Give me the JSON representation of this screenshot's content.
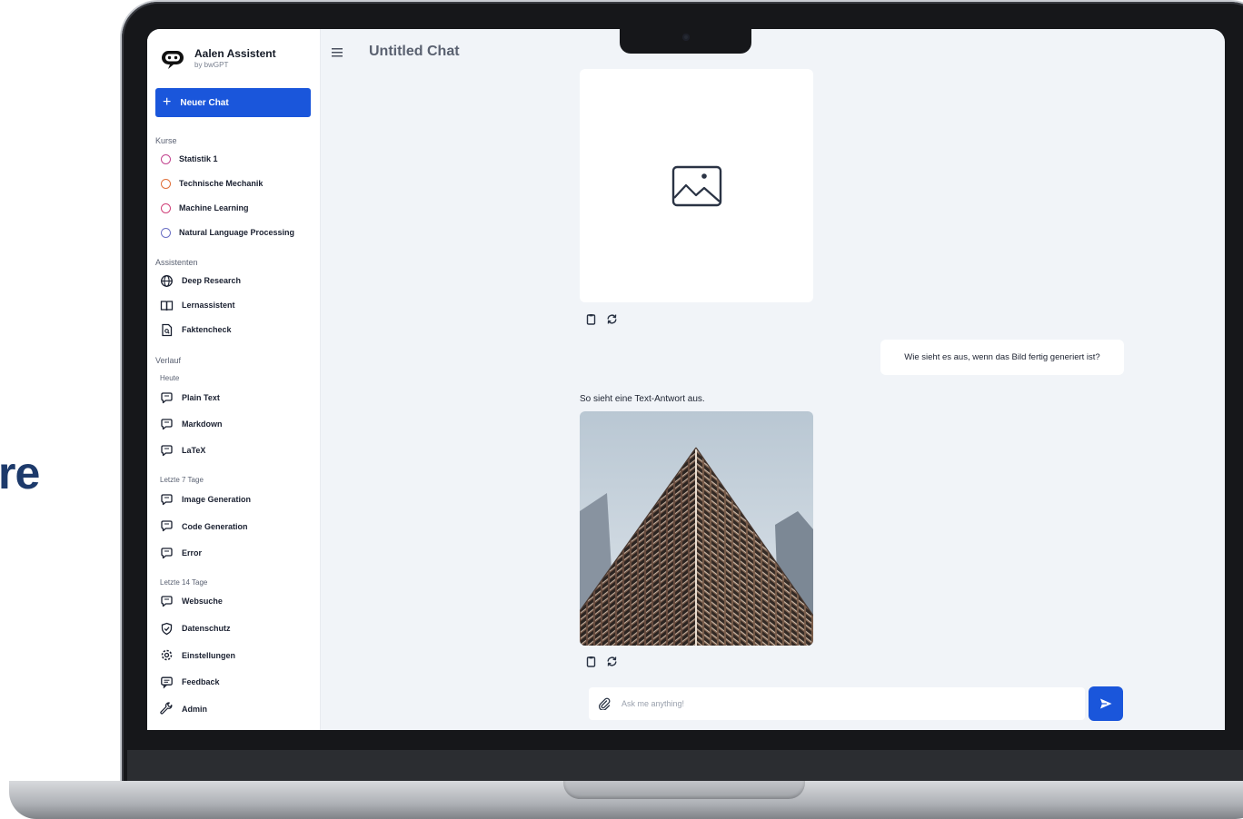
{
  "side_fragment": "re",
  "brand": {
    "title": "Aalen Assistent",
    "subtitle": "by bwGPT"
  },
  "new_chat_label": "Neuer Chat",
  "sections": {
    "courses_label": "Kurse",
    "assistants_label": "Assistenten",
    "history_label": "Verlauf",
    "today_label": "Heute",
    "last7_label": "Letzte 7 Tage",
    "last14_label": "Letzte 14 Tage"
  },
  "courses": [
    {
      "label": "Statistik 1",
      "color": "#c2448f"
    },
    {
      "label": "Technische Mechanik",
      "color": "#e0703a"
    },
    {
      "label": "Machine Learning",
      "color": "#d0427a"
    },
    {
      "label": "Natural Language Processing",
      "color": "#6a6fc4"
    }
  ],
  "assistants": [
    {
      "label": "Deep Research",
      "icon": "globe-icon"
    },
    {
      "label": "Lernassistent",
      "icon": "book-icon"
    },
    {
      "label": "Faktencheck",
      "icon": "document-search-icon"
    }
  ],
  "history_today": [
    {
      "label": "Plain Text",
      "icon": "chat-icon"
    },
    {
      "label": "Markdown",
      "icon": "chat-icon"
    },
    {
      "label": "LaTeX",
      "icon": "chat-icon"
    }
  ],
  "history_last7": [
    {
      "label": "Image Generation",
      "icon": "chat-icon"
    },
    {
      "label": "Code Generation",
      "icon": "chat-icon"
    },
    {
      "label": "Error",
      "icon": "chat-icon"
    }
  ],
  "history_last14": [
    {
      "label": "Websuche",
      "icon": "chat-icon"
    }
  ],
  "footer_links": [
    {
      "label": "Datenschutz",
      "icon": "shield-check-icon"
    },
    {
      "label": "Einstellungen",
      "icon": "gear-icon"
    },
    {
      "label": "Feedback",
      "icon": "message-icon"
    },
    {
      "label": "Admin",
      "icon": "wrench-icon"
    }
  ],
  "chat": {
    "title": "Untitled Chat",
    "user_message": "Wie sieht es aus, wenn das Bild fertig generiert ist?",
    "bot_message": "So sieht eine Text-Antwort aus.",
    "input_placeholder": "Ask me anything!"
  },
  "colors": {
    "accent": "#1a56db",
    "sidebar_bg": "#ffffff",
    "main_bg": "#f1f4f8"
  }
}
